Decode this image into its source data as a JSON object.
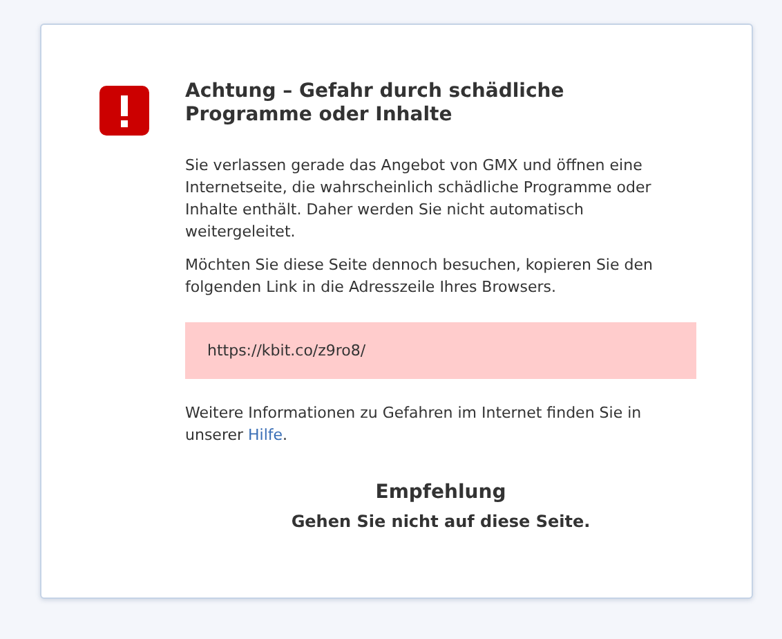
{
  "warning": {
    "title": "Achtung – Gefahr durch schädliche Programme oder Inhalte",
    "paragraphs": [
      "Sie verlassen gerade das Angebot von GMX und öffnen eine Internetseite, die wahrscheinlich schädliche Programme oder Inhalte enthält. Daher werden Sie nicht automatisch weitergeleitet.",
      "Möchten Sie diese Seite dennoch besuchen, kopieren Sie den folgenden Link in die Adresszeile Ihres Browsers."
    ],
    "url": "https://kbit.co/z9ro8/",
    "info": {
      "text": "Weitere Informationen zu Gefahren im Internet finden Sie in unserer",
      "link": "Hilfe",
      "after": "."
    },
    "recommendation": {
      "heading": "Empfehlung",
      "text": "Gehen Sie nicht auf diese Seite."
    }
  }
}
